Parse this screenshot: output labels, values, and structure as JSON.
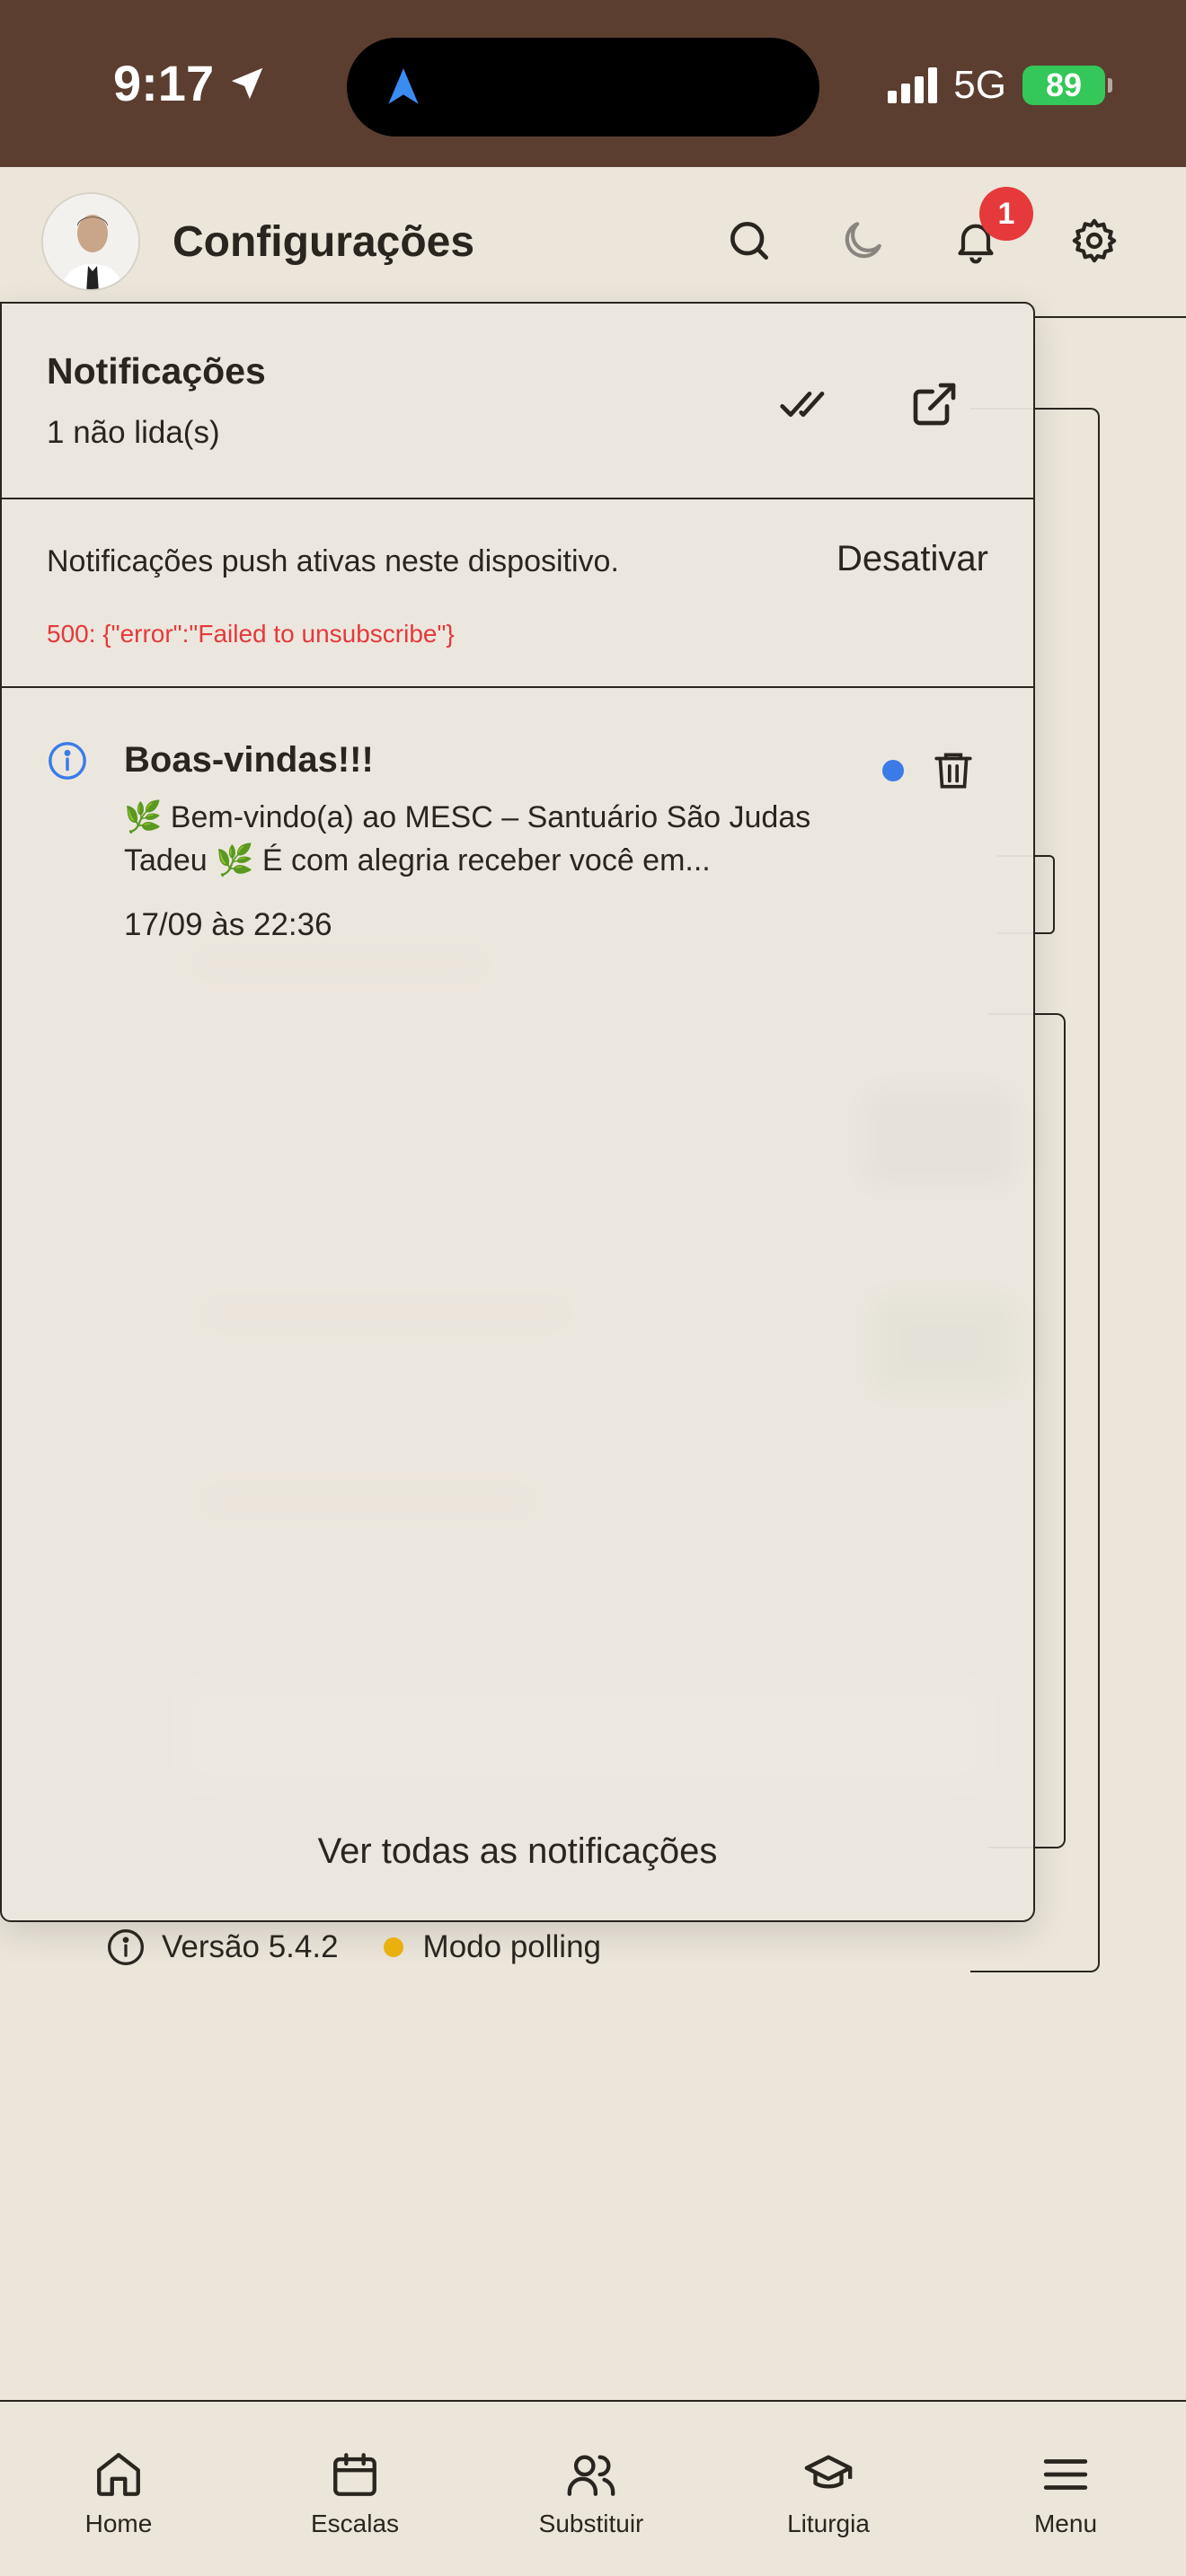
{
  "status_bar": {
    "time": "9:17",
    "network": "5G",
    "battery": "89"
  },
  "header": {
    "title": "Configurações",
    "notification_count": "1",
    "icons": [
      "search-icon",
      "moon-icon",
      "bell-icon",
      "gear-icon"
    ]
  },
  "notifications_panel": {
    "title": "Notificações",
    "unread_label": "1 não lida(s)",
    "push_status": "Notificações push ativas neste dispositivo.",
    "disable_label": "Desativar",
    "error_message": "500: {\"error\":\"Failed to unsubscribe\"}",
    "items": [
      {
        "title": "Boas-vindas!!!",
        "body": "🌿 Bem-vindo(a) ao MESC – Santuário São Judas Tadeu 🌿 É com alegria receber você em...",
        "time": "17/09 às 22:36",
        "unread": true
      }
    ],
    "see_all_label": "Ver todas as notificações"
  },
  "footer_info": {
    "version": "Versão 5.4.2",
    "mode": "Modo polling"
  },
  "bottom_nav": [
    {
      "label": "Home",
      "icon": "home-icon"
    },
    {
      "label": "Escalas",
      "icon": "calendar-icon"
    },
    {
      "label": "Substituir",
      "icon": "users-icon"
    },
    {
      "label": "Liturgia",
      "icon": "graduation-cap-icon"
    },
    {
      "label": "Menu",
      "icon": "menu-icon"
    }
  ],
  "colors": {
    "status_bar_bg": "#5b3e30",
    "page_bg": "#ebe5da",
    "badge": "#e5393b",
    "error_text": "#e5393b",
    "unread_dot": "#3b7be8",
    "polling_dot": "#e9b00e",
    "battery": "#34c759"
  }
}
